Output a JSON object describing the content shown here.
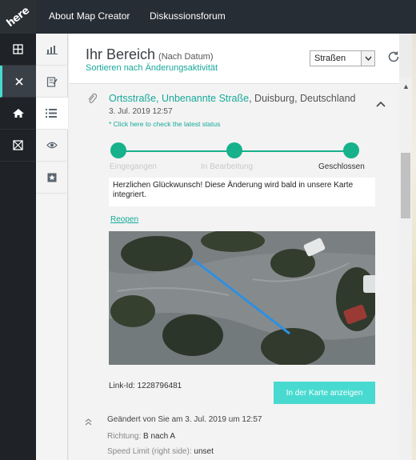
{
  "brand": {
    "logo_text": "here"
  },
  "topbar": {
    "about": "About Map Creator",
    "forum": "Diskussionsforum"
  },
  "rail": [
    {
      "name": "layers-icon",
      "glyph": "grid"
    },
    {
      "name": "close-icon",
      "glyph": "x"
    },
    {
      "name": "community-icon",
      "glyph": "people"
    },
    {
      "name": "satellite-icon",
      "glyph": "box"
    }
  ],
  "panel": {
    "title": "Ihr Bereich",
    "subtitle": "(Nach Datum)",
    "sort_link": "Sortieren nach Änderungsaktivität",
    "filter_value": "Straßen"
  },
  "report": {
    "address_part1": "Ortsstraße, Unbenannte Straße",
    "address_part2": ", Duisburg, Deutschland",
    "date": "3. Jul. 2019 12:57",
    "check_status": "* Click here to check the latest status",
    "stages": [
      "Eingegangen",
      "In Bearbeitung",
      "Geschlossen"
    ],
    "message": "Herzlichen Glückwunsch! Diese Änderung wird bald in unsere Karte integriert.",
    "reopen": "Reopen",
    "link_id": "Link-Id: 1228796481",
    "show_on_map": "In der Karte anzeigen",
    "changed_by": "Geändert von Sie am 3. Jul. 2019 um 12:57",
    "direction_label": "Richtung:",
    "direction_value": "B nach A",
    "speed_label": "Speed Limit (right side):",
    "speed_value": "unset"
  },
  "colors": {
    "accent": "#17a99a",
    "progress": "#17b18c",
    "button": "#48dad0",
    "rail": "#1f2327",
    "topbar": "#272d34"
  }
}
